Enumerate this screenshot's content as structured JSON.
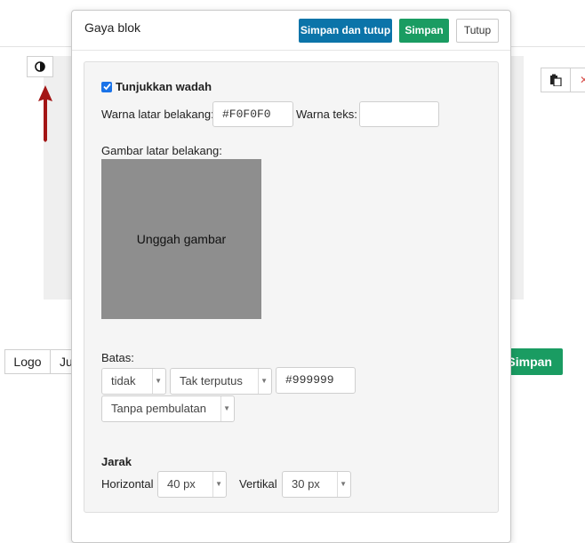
{
  "background": {
    "logo_label": "Logo",
    "ju_label": "Ju",
    "save_label": "Simpan"
  },
  "modal": {
    "title": "Gaya blok",
    "buttons": {
      "save_close": "Simpan dan tutup",
      "save": "Simpan",
      "close": "Tutup"
    },
    "show_container": {
      "label": "Tunjukkan wadah",
      "checked": true
    },
    "bg_color": {
      "label": "Warna latar belakang:",
      "value": "#F0F0F0"
    },
    "text_color": {
      "label": "Warna teks:",
      "value": ""
    },
    "bg_image": {
      "label": "Gambar latar belakang:",
      "upload_label": "Unggah gambar"
    },
    "border": {
      "label": "Batas:",
      "style_value": "tidak",
      "line_value": "Tak terputus",
      "color_value": "#999999",
      "rounding_value": "Tanpa pembulatan"
    },
    "spacing": {
      "label": "Jarak",
      "horizontal_label": "Horizontal",
      "horizontal_value": "40 px",
      "vertical_label": "Vertikal",
      "vertical_value": "30 px"
    }
  },
  "colors": {
    "blue_button": "#0b74a9",
    "green_button": "#1a9c62",
    "arrow": "#a31515",
    "upload_bg": "#8e8e8e"
  },
  "icons": [
    "contrast-icon",
    "arrow-up-icon",
    "paste-icon",
    "checkbox-checked-icon",
    "caret-down-icon"
  ]
}
